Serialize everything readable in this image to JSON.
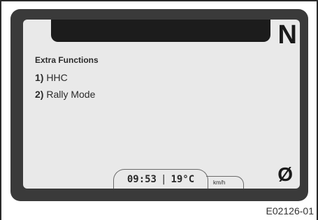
{
  "display": {
    "gear_indicator": "N",
    "menu": {
      "title": "Extra Functions",
      "items": [
        {
          "number": "1)",
          "label": "HHC"
        },
        {
          "number": "2)",
          "label": "Rally Mode"
        }
      ]
    },
    "status": {
      "time": "09:53",
      "separator": "|",
      "temperature": "19°C",
      "speed_unit": "km/h"
    },
    "trip_icon_glyph": "Ø"
  },
  "figure_caption": "E02126-01"
}
